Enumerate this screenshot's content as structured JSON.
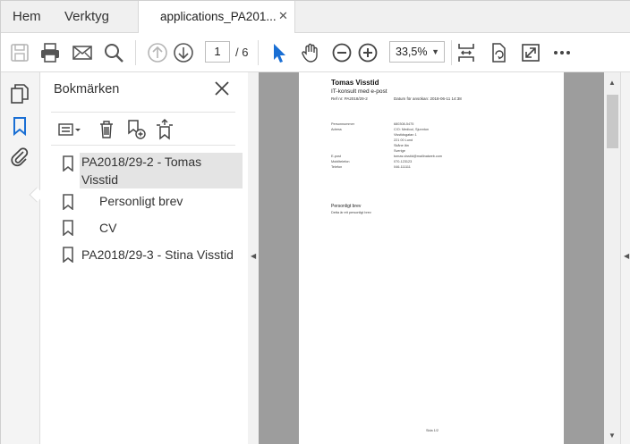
{
  "tabs": {
    "home": "Hem",
    "tools": "Verktyg",
    "document": "applications_PA201...",
    "close": "✕"
  },
  "toolbar": {
    "page_current": "1",
    "page_total": "/ 6",
    "zoom": "33,5%"
  },
  "panel": {
    "title": "Bokmärken",
    "bookmarks": [
      {
        "label_line1": "PA2018/29-2 - Tomas",
        "label_line2": "Visstid"
      },
      {
        "label": "Personligt brev"
      },
      {
        "label": "CV"
      },
      {
        "label": "PA2018/29-3 - Stina Visstid"
      }
    ]
  },
  "document": {
    "name": "Tomas Visstid",
    "role": "IT-konsult med e-post",
    "ref": "Ref nr: PA2018/29-2",
    "date": "Datum för ansökan: 2018-06-11 14:38",
    "fields": [
      {
        "label": "Personnummer",
        "value": "680308-5475"
      },
      {
        "label": "Adress",
        "value": "C/O: Medicul, Sjunnton"
      },
      {
        "label": "",
        "value": "Visstidsgatan 1"
      },
      {
        "label": "",
        "value": "221 00 Lund"
      },
      {
        "label": "",
        "value": "Skåne län"
      },
      {
        "label": "",
        "value": "Sverige"
      },
      {
        "label": "E-post",
        "value": "tomas.visstid@mailinatweb.com"
      },
      {
        "label": "Mobiltelefon",
        "value": "070-123123"
      },
      {
        "label": "Telefon",
        "value": "046-111111"
      }
    ],
    "section_title": "Personligt brev",
    "section_text": "Detta är ett personligt brev",
    "footer": "Sida 1/2"
  }
}
